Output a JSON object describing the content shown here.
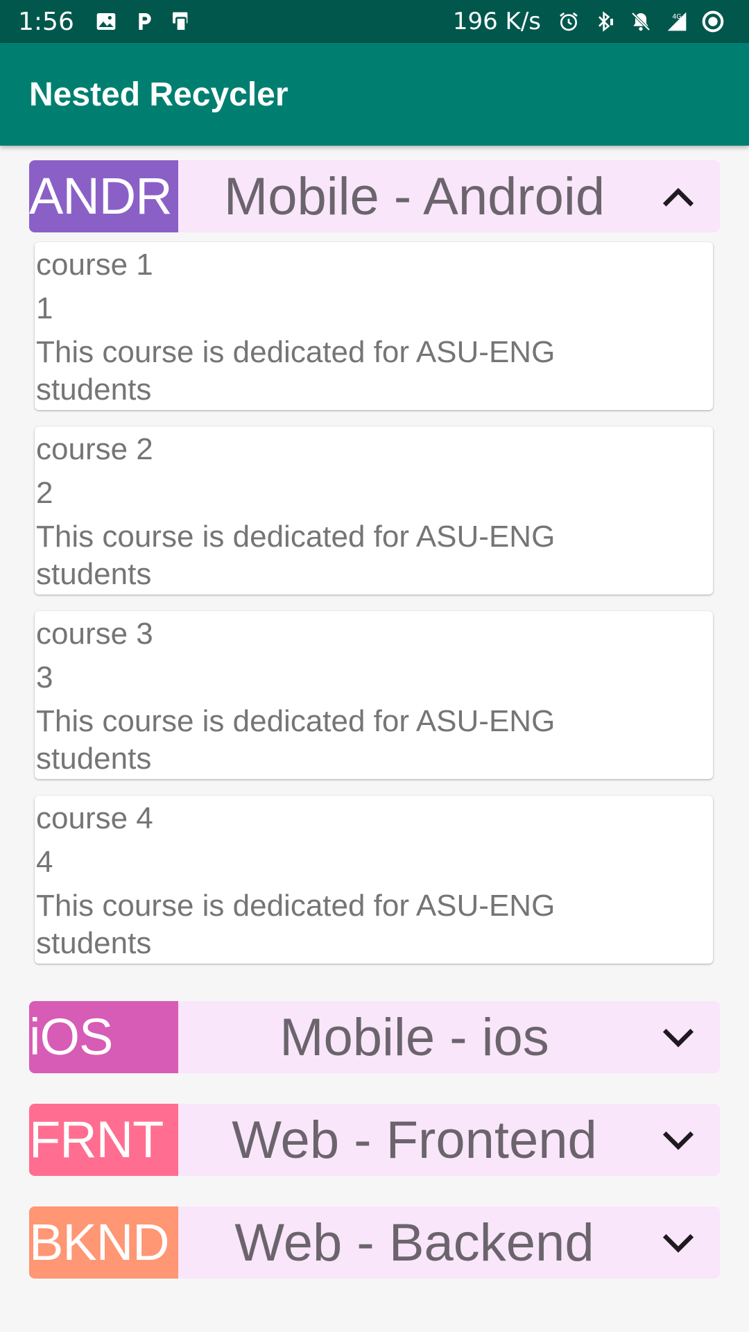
{
  "status_bar": {
    "time": "1:56",
    "speed": "196 K/s",
    "left_icons": [
      "image-icon",
      "p-icon",
      "phone-sync-icon"
    ],
    "right_icons": [
      "alarm-icon",
      "bluetooth-icon",
      "notifications-off-icon",
      "signal-4g-icon",
      "record-icon"
    ],
    "network_label": "4G"
  },
  "app_bar": {
    "title": "Nested Recycler",
    "color": "#007f71"
  },
  "categories": [
    {
      "code": "ANDR",
      "name": "Mobile - Android",
      "code_color": "#8a60c7",
      "expanded": true,
      "courses": [
        {
          "name": "course 1",
          "number": "1",
          "description": "This course is dedicated for ASU-ENG students"
        },
        {
          "name": "course 2",
          "number": "2",
          "description": "This course is dedicated for ASU-ENG students"
        },
        {
          "name": "course 3",
          "number": "3",
          "description": "This course is dedicated for ASU-ENG students"
        },
        {
          "name": "course 4",
          "number": "4",
          "description": "This course is dedicated for ASU-ENG students"
        }
      ]
    },
    {
      "code": "iOS",
      "name": "Mobile - ios",
      "code_color": "#d65cb6",
      "expanded": false
    },
    {
      "code": "FRNT",
      "name": "Web - Frontend",
      "code_color": "#ff6e90",
      "expanded": false
    },
    {
      "code": "BKND",
      "name": "Web - Backend",
      "code_color": "#ff9674",
      "expanded": false
    }
  ]
}
